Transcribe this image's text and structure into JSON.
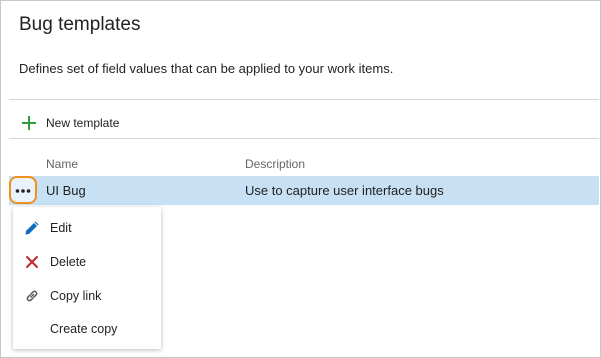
{
  "page": {
    "title": "Bug templates",
    "description": "Defines set of field values that can be applied to your work items."
  },
  "toolbar": {
    "new_template_label": "New template",
    "new_template_icon": "plus-icon"
  },
  "table": {
    "columns": [
      "Name",
      "Description"
    ],
    "rows": [
      {
        "name": "UI Bug",
        "description": "Use to capture user interface bugs",
        "selected": true
      }
    ]
  },
  "context_menu": {
    "items": [
      {
        "label": "Edit",
        "icon": "pencil-icon"
      },
      {
        "label": "Delete",
        "icon": "x-icon"
      },
      {
        "label": "Copy link",
        "icon": "link-icon"
      },
      {
        "label": "Create copy",
        "icon": ""
      }
    ]
  },
  "colors": {
    "accent_green": "#2f9e3a",
    "selected_row": "#c7e0f4",
    "focus_ring": "#f0901d",
    "edit_icon": "#0f6cbd",
    "delete_icon": "#c4262e"
  }
}
